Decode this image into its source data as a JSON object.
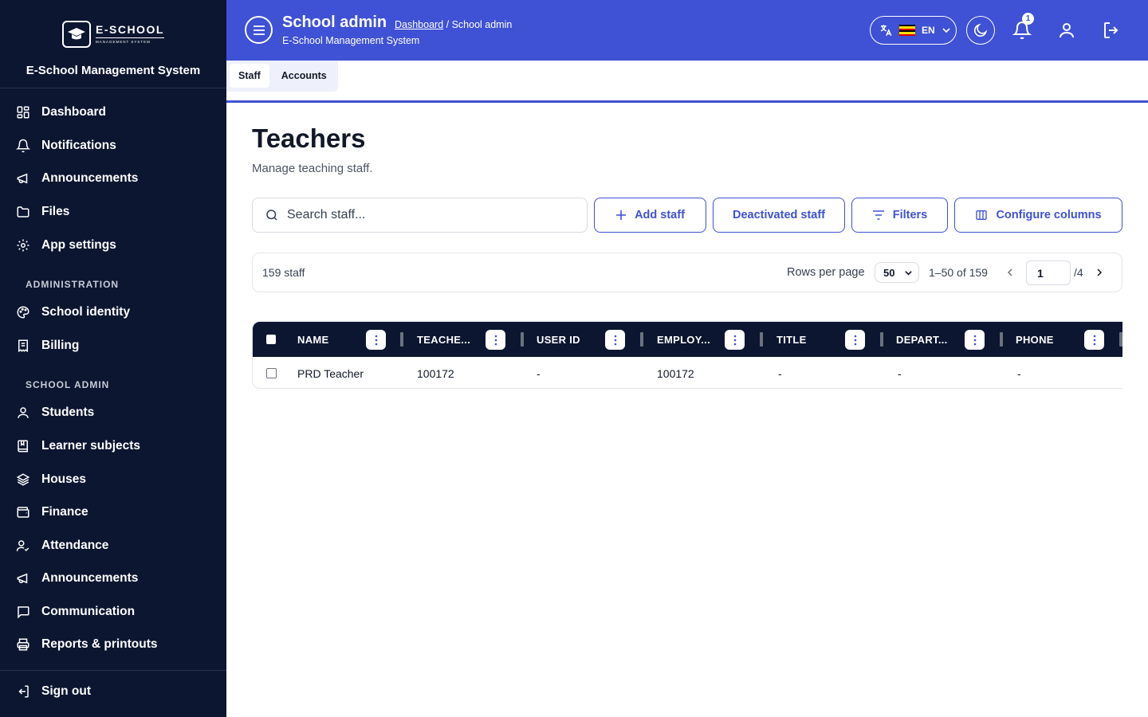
{
  "sidebar": {
    "logo": {
      "main": "E-SCHOOL",
      "sub": "MANAGEMENT SYSTEM"
    },
    "system_name": "E-School Management System",
    "items": [
      {
        "label": "Dashboard",
        "icon": "dashboard-icon"
      },
      {
        "label": "Notifications",
        "icon": "bell-icon"
      },
      {
        "label": "Announcements",
        "icon": "megaphone-icon"
      },
      {
        "label": "Files",
        "icon": "folder-icon"
      },
      {
        "label": "App settings",
        "icon": "gear-icon"
      }
    ],
    "section_admin": "ADMINISTRATION",
    "admin_items": [
      {
        "label": "School identity",
        "icon": "palette-icon"
      },
      {
        "label": "Billing",
        "icon": "receipt-icon"
      }
    ],
    "section_school": "SCHOOL ADMIN",
    "school_items": [
      {
        "label": "Students",
        "icon": "user-icon"
      },
      {
        "label": "Learner subjects",
        "icon": "book-icon"
      },
      {
        "label": "Houses",
        "icon": "layers-icon"
      },
      {
        "label": "Finance",
        "icon": "wallet-icon"
      },
      {
        "label": "Attendance",
        "icon": "user-check-icon"
      },
      {
        "label": "Announcements",
        "icon": "megaphone-icon"
      },
      {
        "label": "Communication",
        "icon": "chat-icon"
      },
      {
        "label": "Reports & printouts",
        "icon": "printer-icon"
      }
    ],
    "sign_out": "Sign out"
  },
  "header": {
    "title": "School admin",
    "breadcrumb_link": "Dashboard",
    "breadcrumb_current": " / School admin",
    "subtitle": "E-School Management System",
    "language": "EN",
    "notification_count": "1"
  },
  "tabs": [
    "Staff",
    "Accounts"
  ],
  "main": {
    "title": "Teachers",
    "subtitle": "Manage teaching staff.",
    "search_placeholder": "Search staff...",
    "buttons": {
      "add": "Add staff",
      "deactivated": "Deactivated staff",
      "filters": "Filters",
      "columns": "Configure columns"
    }
  },
  "pagination": {
    "count": "159 staff",
    "rows_label": "Rows per page",
    "rows_value": "50",
    "range": "1–50 of 159",
    "page": "1",
    "total_pages": "/4"
  },
  "table": {
    "columns": [
      "NAME",
      "TEACHE...",
      "USER ID",
      "EMPLOY...",
      "TITLE",
      "DEPART...",
      "PHONE"
    ],
    "rows": [
      [
        "PRD Teacher",
        "100172",
        "-",
        "100172",
        "-",
        "-",
        "-"
      ]
    ]
  },
  "colors": {
    "accent": "#3f51d4",
    "sidebar": "#0c1631"
  }
}
